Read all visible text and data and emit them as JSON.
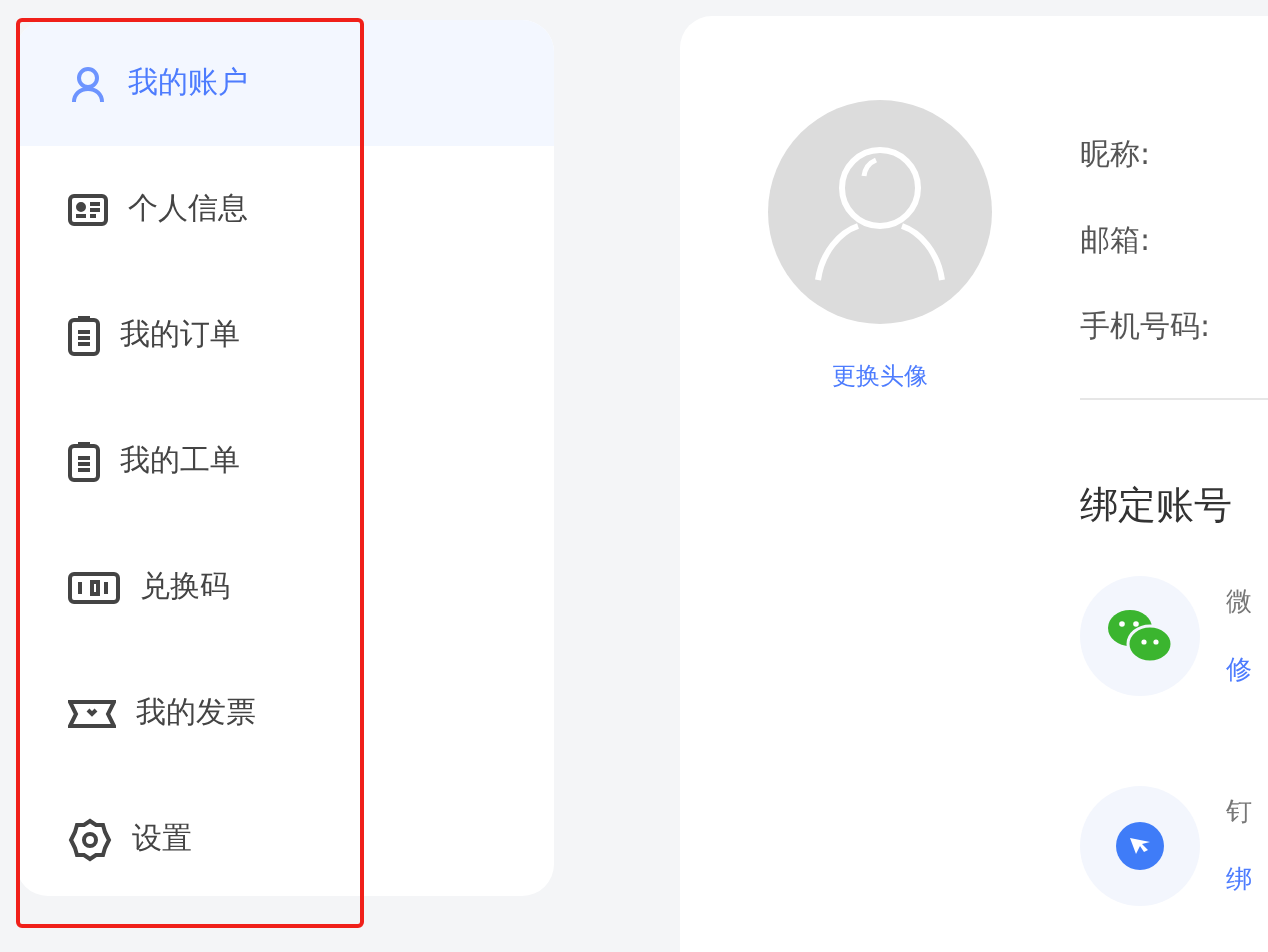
{
  "sidebar": {
    "items": [
      {
        "label": "我的账户",
        "kind": "user",
        "selected": true
      },
      {
        "label": "个人信息",
        "kind": "idcard",
        "selected": false
      },
      {
        "label": "我的订单",
        "kind": "clipboard",
        "selected": false
      },
      {
        "label": "我的工单",
        "kind": "clipboard",
        "selected": false
      },
      {
        "label": "兑换码",
        "kind": "code",
        "selected": false
      },
      {
        "label": "我的发票",
        "kind": "ticket",
        "selected": false
      },
      {
        "label": "设置",
        "kind": "gear",
        "selected": false
      }
    ]
  },
  "profile": {
    "change_avatar": "更换头像",
    "fields": [
      {
        "label": "昵称:"
      },
      {
        "label": "邮箱:"
      },
      {
        "label": "手机号码:"
      }
    ]
  },
  "bindings": {
    "title": "绑定账号",
    "accounts": [
      {
        "kind": "wechat",
        "name": "微",
        "action": "修"
      },
      {
        "kind": "dingtalk",
        "name": "钉",
        "action": "绑"
      }
    ]
  },
  "annotation": {
    "kind": "highlight"
  }
}
